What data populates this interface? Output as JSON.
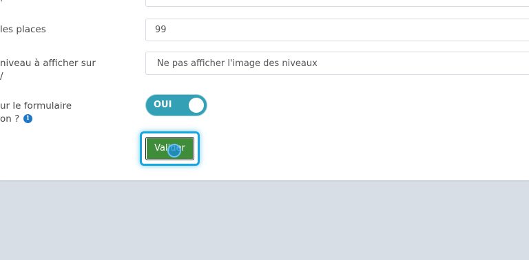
{
  "form": {
    "fields": {
      "places": {
        "label": "les places",
        "value": "99"
      },
      "niveau": {
        "label_line1": "niveau à afficher sur",
        "label_line2": "/",
        "selected": "Ne pas afficher l'image des niveaux"
      },
      "formulaire": {
        "label_line1": "ur le formulaire",
        "label_line2": "on ?",
        "info_icon": "info-icon",
        "toggle_label": "OUI",
        "toggle_state": "on"
      }
    },
    "submit_label": "Valider"
  },
  "colors": {
    "toggle": "#34a0b5",
    "submit": "#3f8c3a",
    "focus": "#17a5df",
    "background": "#d8dee6",
    "info_icon": "#1f78c6"
  }
}
